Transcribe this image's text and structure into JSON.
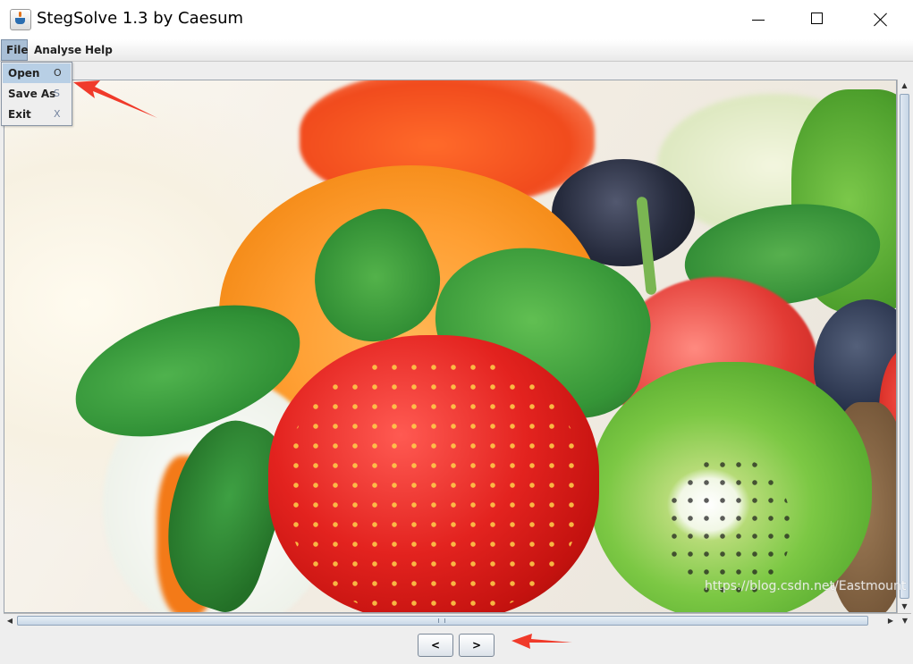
{
  "window": {
    "title": "StegSolve 1.3 by Caesum"
  },
  "menubar": {
    "file": "File",
    "analyse": "Analyse",
    "help": "Help"
  },
  "file_menu": {
    "items": [
      {
        "label": "Open",
        "accelerator": "O"
      },
      {
        "label": "Save As",
        "accelerator": "S"
      },
      {
        "label": "Exit",
        "accelerator": "X"
      }
    ]
  },
  "navigation": {
    "prev_label": "<",
    "next_label": ">"
  },
  "watermark": "https://blog.csdn.net/Eastmount",
  "colors": {
    "menu_highlight": "#b8cfe5",
    "annotation_arrow": "#f03a2a",
    "scroll_thumb": "#c9d8e7"
  },
  "icons": {
    "app_icon": "java-cup-icon",
    "minimize": "minimize-icon",
    "maximize": "maximize-icon",
    "close": "close-icon"
  }
}
